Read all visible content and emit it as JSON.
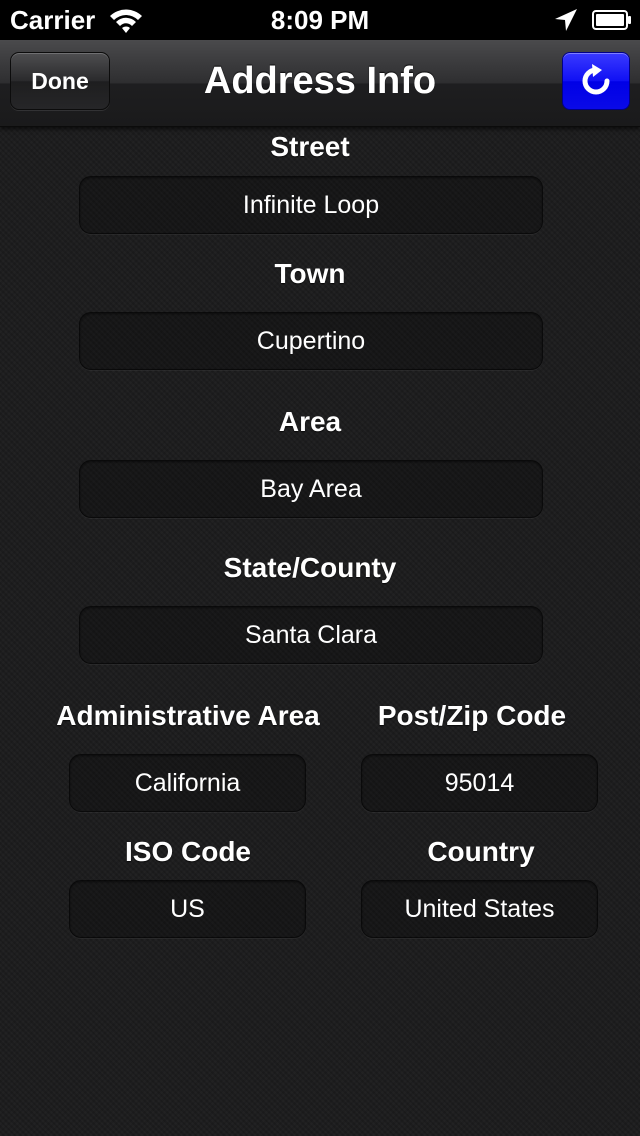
{
  "status_bar": {
    "carrier": "Carrier",
    "time": "8:09 PM",
    "icons": [
      "wifi-icon",
      "location-arrow-icon",
      "battery-icon"
    ]
  },
  "navbar": {
    "title": "Address Info",
    "done_label": "Done",
    "refresh_icon": "refresh-icon",
    "refresh_color": "#0000ff"
  },
  "fields": {
    "street": {
      "label": "Street",
      "value": "Infinite Loop"
    },
    "town": {
      "label": "Town",
      "value": "Cupertino"
    },
    "area": {
      "label": "Area",
      "value": "Bay Area"
    },
    "state": {
      "label": "State/County",
      "value": "Santa Clara"
    },
    "admin_area": {
      "label": "Administrative Area",
      "value": "California"
    },
    "postcode": {
      "label": "Post/Zip Code",
      "value": "95014"
    },
    "iso_code": {
      "label": "ISO Code",
      "value": "US"
    },
    "country": {
      "label": "Country",
      "value": "United States"
    }
  }
}
